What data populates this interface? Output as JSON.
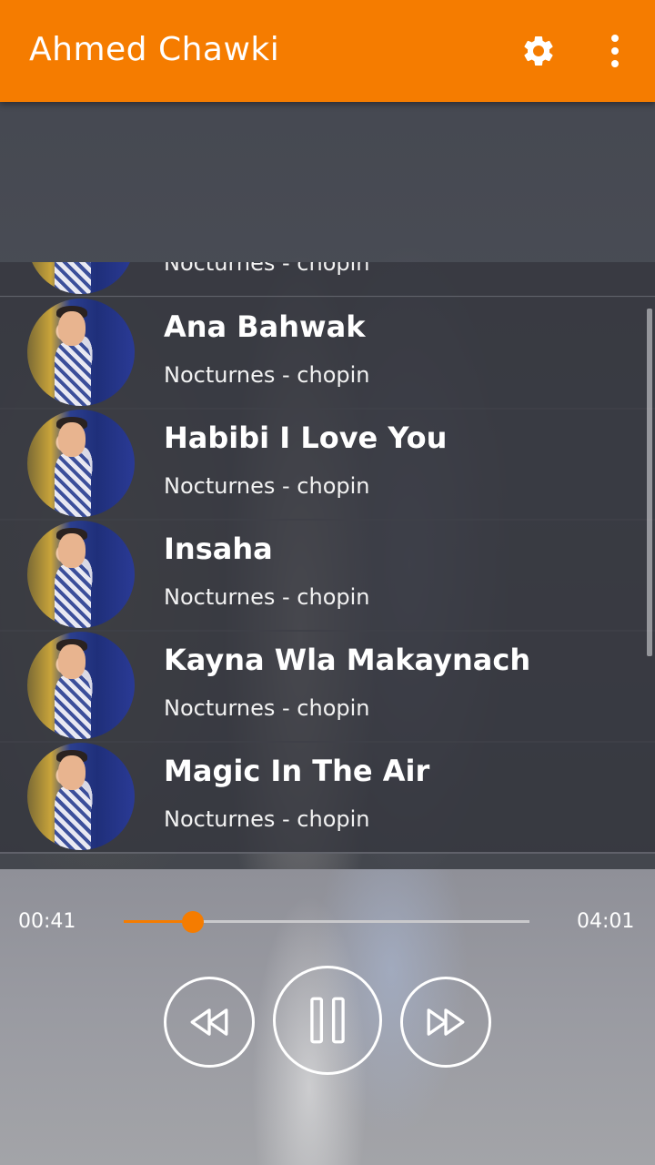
{
  "app_bar": {
    "title": "Ahmed Chawki",
    "settings_icon": "gear-icon",
    "menu_icon": "more-vert-icon",
    "color": "#f57c00"
  },
  "songs": [
    {
      "title": "",
      "artist": "Nocturnes - chopin"
    },
    {
      "title": "Ana Bahwak",
      "artist": "Nocturnes - chopin"
    },
    {
      "title": "Habibi I Love You",
      "artist": "Nocturnes - chopin"
    },
    {
      "title": "Insaha",
      "artist": "Nocturnes - chopin"
    },
    {
      "title": "Kayna Wla Makaynach",
      "artist": "Nocturnes - chopin"
    },
    {
      "title": "Magic In The Air",
      "artist": "Nocturnes - chopin"
    }
  ],
  "player": {
    "current_time": "00:41",
    "total_time": "04:01",
    "progress": 0.17,
    "accent": "#f57c00",
    "prev_icon": "rewind-icon",
    "play_icon": "pause-icon",
    "next_icon": "fast-forward-icon"
  }
}
